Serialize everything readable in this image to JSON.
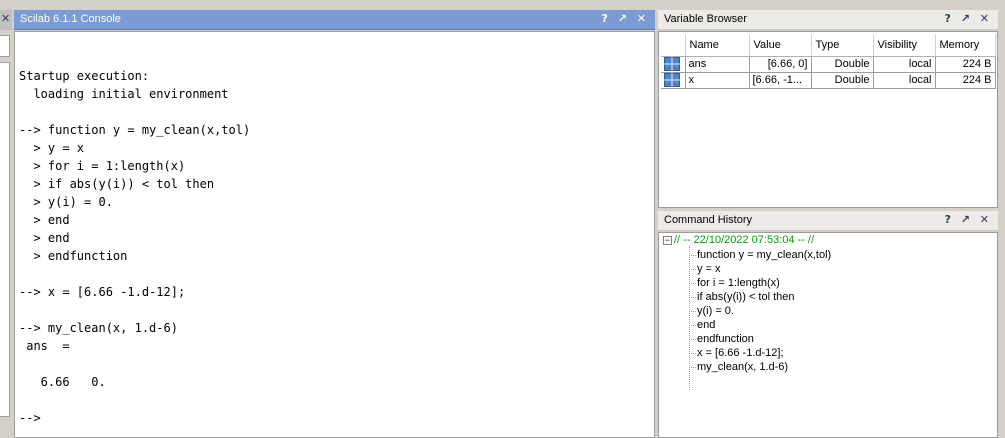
{
  "console": {
    "title": "Scilab 6.1.1 Console",
    "window_buttons": "? ↗ ✕",
    "output": "Startup execution:\n  loading initial environment\n\n--> function y = my_clean(x,tol)\n  > y = x\n  > for i = 1:length(x)\n  > if abs(y(i)) < tol then\n  > y(i) = 0.\n  > end\n  > end\n  > endfunction\n\n--> x = [6.66 -1.d-12];\n\n--> my_clean(x, 1.d-6)\n ans  =\n\n   6.66   0.\n\n-->"
  },
  "left_pane": {
    "close_label": "✕"
  },
  "variable_browser": {
    "title": "Variable Browser",
    "window_buttons": "? ↗ ✕",
    "columns": [
      "Name",
      "Value",
      "Type",
      "Visibility",
      "Memory"
    ],
    "rows": [
      {
        "name": "ans",
        "value": "[6.66, 0]",
        "type": "Double",
        "visibility": "local",
        "memory": "224 B",
        "icon": "matrix-icon"
      },
      {
        "name": "x",
        "value": "[6.66, -1...",
        "type": "Double",
        "visibility": "local",
        "memory": "224 B",
        "icon": "matrix-icon"
      }
    ]
  },
  "command_history": {
    "title": "Command History",
    "window_buttons": "? ↗ ✕",
    "session_label": "// -- 22/10/2022 07:53:04 -- //",
    "items": [
      "function y = my_clean(x,tol)",
      "y = x",
      "for i = 1:length(x)",
      "if abs(y(i)) < tol then",
      "y(i) = 0.",
      "end",
      "endfunction",
      "x = [6.66 -1.d-12];",
      "my_clean(x, 1.d-6)"
    ]
  },
  "colors": {
    "console_titlebar": "#7c9bd3",
    "history_session": "#00a000",
    "panel_background": "#d4d0c8"
  }
}
